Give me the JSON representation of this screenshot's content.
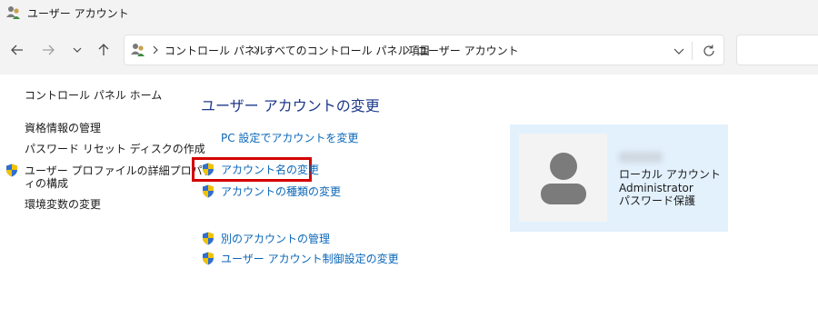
{
  "window": {
    "title": "ユーザー アカウント"
  },
  "breadcrumb": [
    "コントロール パネル",
    "すべてのコントロール パネル項目",
    "ユーザー アカウント"
  ],
  "sidebar": {
    "home": "コントロール パネル ホーム",
    "items": [
      "資格情報の管理",
      "パスワード リセット ディスクの作成",
      "ユーザー プロファイルの詳細プロパテ",
      "ィの構成",
      "環境変数の変更"
    ]
  },
  "main": {
    "heading": "ユーザー アカウントの変更",
    "tasks": [
      "PC 設定でアカウントを変更",
      "アカウント名の変更",
      "アカウントの種類の変更"
    ],
    "other_tasks": [
      "別のアカウントの管理",
      "ユーザー アカウント制御設定の変更"
    ]
  },
  "account": {
    "name": "admin",
    "type": "ローカル アカウント",
    "role": "Administrator",
    "protection": "パスワード保護"
  },
  "colors": {
    "link": "#0b67b8",
    "heading": "#1e3a8a",
    "highlight": "#d40000",
    "card": "#e3f1fd"
  }
}
